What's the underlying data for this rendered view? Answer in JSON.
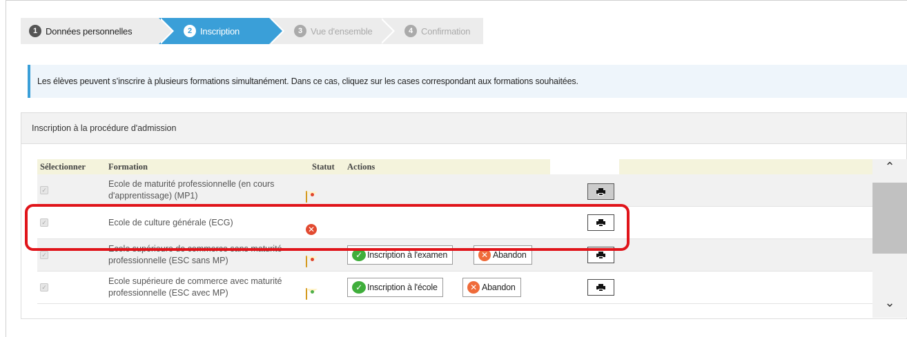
{
  "wizard": {
    "steps": [
      {
        "num": "1",
        "label": "Données personnelles"
      },
      {
        "num": "2",
        "label": "Inscription"
      },
      {
        "num": "3",
        "label": "Vue d'ensemble"
      },
      {
        "num": "4",
        "label": "Confirmation"
      }
    ],
    "active_step": 2
  },
  "info_banner": "Les élèves peuvent s’inscrire à plusieurs formations simultanément. Dans ce cas, cliquez sur les cases correspondant aux formations souhaitées.",
  "panel": {
    "title": "Inscription à la procédure d'admission",
    "columns": {
      "select": "Sélectionner",
      "formation": "Formation",
      "status": "Statut",
      "actions": "Actions"
    },
    "rows": [
      {
        "formation": "Ecole de maturité professionnelle (en cours d'apprentissage) (MP1)",
        "status_icon": "envelope-red-icon"
      },
      {
        "formation": "Ecole de culture générale (ECG)",
        "status_icon": "x-circle-icon",
        "highlighted": true
      },
      {
        "formation": "Ecole supérieure de commerce sans maturité professionnelle (ESC sans MP)",
        "status_icon": "envelope-red-icon",
        "action_primary": "Inscription à l'examen",
        "action_abandon": "Abandon"
      },
      {
        "formation": "Ecole supérieure de commerce avec maturité professionnelle (ESC avec MP)",
        "status_icon": "envelope-green-icon",
        "action_primary": "Inscription à l'école",
        "action_abandon": "Abandon"
      }
    ]
  },
  "colors": {
    "active_step": "#3a9fd8",
    "header_row": "#f4f3dc",
    "highlight": "#e0141a"
  }
}
